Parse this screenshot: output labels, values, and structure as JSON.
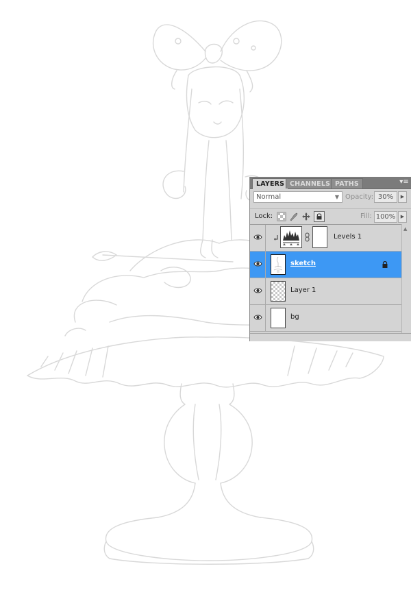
{
  "panel": {
    "tabs": [
      {
        "label": "LAYERS",
        "active": true
      },
      {
        "label": "CHANNELS",
        "active": false
      },
      {
        "label": "PATHS",
        "active": false
      }
    ],
    "menu_icon": "panel-menu-icon"
  },
  "blend": {
    "mode": "Normal",
    "opacity_label": "Opacity:",
    "opacity_value": "30%"
  },
  "lock": {
    "label": "Lock:",
    "fill_label": "Fill:",
    "fill_value": "100%",
    "lock_all_active": true
  },
  "layers": [
    {
      "name": "Levels 1",
      "type": "adjustment",
      "visible": true,
      "selected": false,
      "clipped": true
    },
    {
      "name": "sketch",
      "type": "pixel",
      "visible": true,
      "selected": true,
      "locked": true
    },
    {
      "name": "Layer 1",
      "type": "transparent",
      "visible": true,
      "selected": false
    },
    {
      "name": "bg",
      "type": "fill-white",
      "visible": true,
      "selected": false
    }
  ],
  "colors": {
    "selection": "#3d98f4",
    "panel_bg": "#d4d4d4",
    "tabbar_bg": "#7b7b7b"
  }
}
